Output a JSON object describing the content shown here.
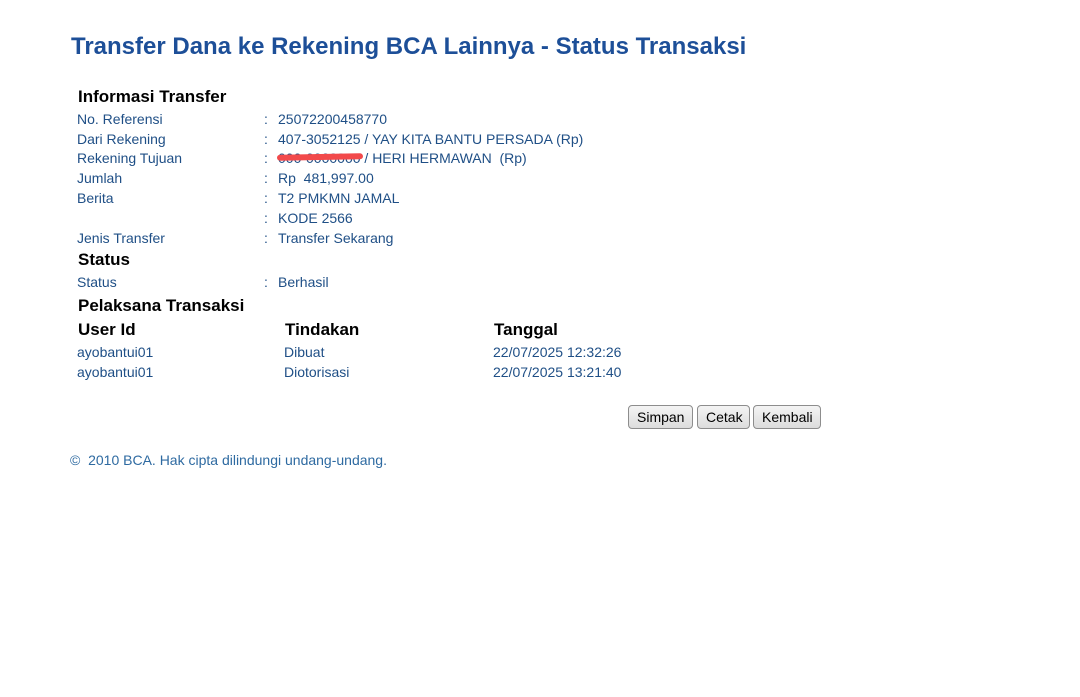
{
  "page": {
    "title": "Transfer Dana ke Rekening BCA Lainnya - Status Transaksi"
  },
  "info_transfer": {
    "heading": "Informasi Transfer",
    "colon": ":",
    "rows": [
      {
        "label": "No. Referensi",
        "value": "25072200458770"
      },
      {
        "label": "Dari Rekening",
        "value": "407-3052125 / YAY KITA BANTU PERSADA  (Rp)"
      },
      {
        "label": "Rekening Tujuan",
        "value_redacted": "000-0000000",
        "value": " / HERI HERMAWAN  (Rp)"
      },
      {
        "label": "Jumlah",
        "value": "Rp  481,997.00"
      },
      {
        "label": "Berita",
        "value": "T2 PMKMN JAMAL"
      },
      {
        "label": "",
        "value": "KODE 2566"
      },
      {
        "label": "Jenis Transfer",
        "value": "Transfer Sekarang"
      }
    ]
  },
  "status": {
    "heading": "Status",
    "label": "Status",
    "value": "Berhasil"
  },
  "pelaksana": {
    "heading": "Pelaksana Transaksi",
    "columns": [
      "User Id",
      "Tindakan",
      "Tanggal"
    ],
    "rows": [
      {
        "user_id": "ayobantui01",
        "tindakan": "Dibuat",
        "tanggal": "22/07/2025 12:32:26"
      },
      {
        "user_id": "ayobantui01",
        "tindakan": "Diotorisasi",
        "tanggal": "22/07/2025 13:21:40"
      }
    ]
  },
  "buttons": {
    "simpan": "Simpan",
    "cetak": "Cetak",
    "kembali": "Kembali"
  },
  "footer": {
    "copyright": "©  2010 BCA. Hak cipta dilindungi undang-undang."
  }
}
